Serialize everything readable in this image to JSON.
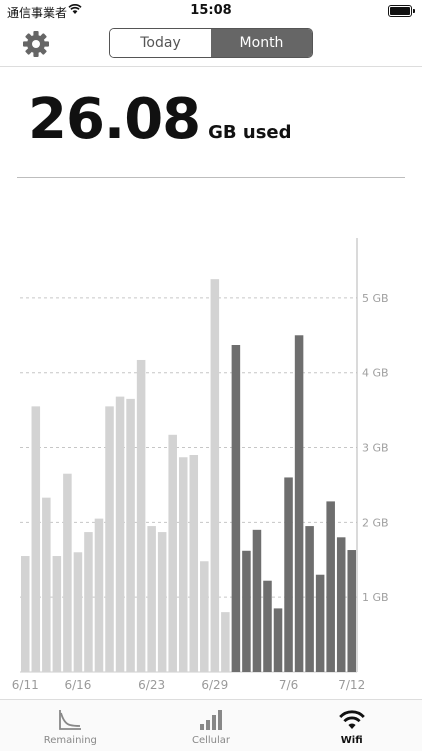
{
  "status_bar": {
    "carrier": "通信事業者",
    "time": "15:08"
  },
  "header": {
    "settings_icon": "gear-icon",
    "segments": [
      {
        "label": "Today",
        "selected": false
      },
      {
        "label": "Month",
        "selected": true
      }
    ]
  },
  "usage": {
    "value": "26.08",
    "unit": "GB used"
  },
  "chart_data": {
    "type": "bar",
    "x": [
      "6/11",
      "6/12",
      "6/13",
      "6/14",
      "6/15",
      "6/16",
      "6/17",
      "6/18",
      "6/19",
      "6/20",
      "6/21",
      "6/22",
      "6/23",
      "6/24",
      "6/25",
      "6/26",
      "6/27",
      "6/28",
      "6/29",
      "6/30",
      "7/1",
      "7/2",
      "7/3",
      "7/4",
      "7/5",
      "7/6",
      "7/7",
      "7/8",
      "7/9",
      "7/10",
      "7/11",
      "7/12"
    ],
    "series": [
      {
        "values": [
          1.55,
          3.55,
          2.33,
          1.55,
          2.65,
          1.6,
          1.87,
          2.05,
          3.55,
          3.68,
          3.65,
          4.17,
          1.95,
          1.87,
          3.17,
          2.87,
          2.9,
          1.48,
          5.25,
          0.8,
          null,
          null,
          null,
          null,
          null,
          null,
          null,
          null,
          null,
          null,
          null,
          null
        ],
        "color": "#d3d3d3"
      },
      {
        "values": [
          null,
          null,
          null,
          null,
          null,
          null,
          null,
          null,
          null,
          null,
          null,
          null,
          null,
          null,
          null,
          null,
          null,
          null,
          null,
          null,
          4.37,
          1.62,
          1.9,
          1.22,
          0.85,
          2.6,
          4.5,
          1.95,
          1.3,
          2.28,
          1.8,
          1.63
        ],
        "color": "#6e6e6e"
      }
    ],
    "x_tick_labels": [
      "6/11",
      "6/16",
      "6/23",
      "6/29",
      "7/6",
      "7/12"
    ],
    "y_ticks": [
      1,
      2,
      3,
      4,
      5
    ],
    "y_tick_labels": [
      "1 GB",
      "2 GB",
      "3 GB",
      "4 GB",
      "5 GB"
    ],
    "ylim": [
      0,
      5.8
    ],
    "grid": true
  },
  "tabs": [
    {
      "label": "Remaining",
      "icon": "remaining-chart-icon",
      "active": false
    },
    {
      "label": "Cellular",
      "icon": "cellular-bars-icon",
      "active": false
    },
    {
      "label": "Wifi",
      "icon": "wifi-icon",
      "active": true
    }
  ]
}
